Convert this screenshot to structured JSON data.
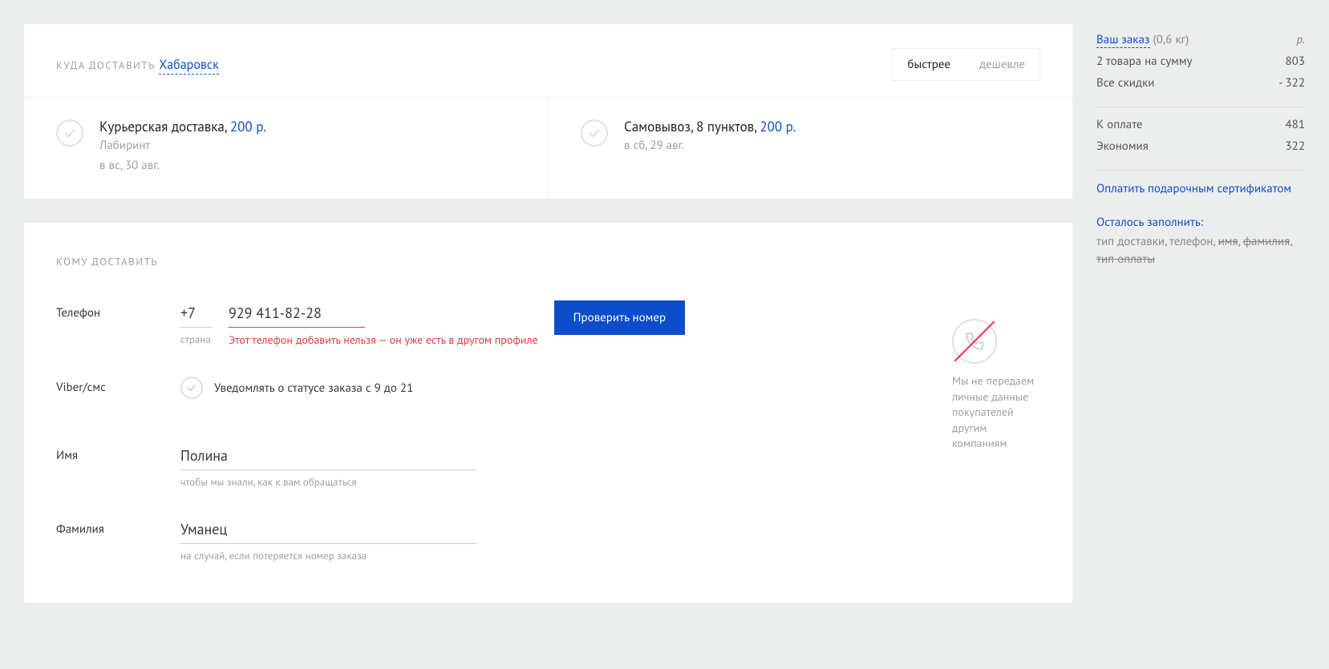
{
  "delivery_section": {
    "label": "КУДА ДОСТАВИТЬ",
    "city": "Хабаровск",
    "toggle": {
      "faster": "быстрее",
      "cheaper": "дешевле"
    },
    "options": [
      {
        "title": "Курьерская доставка,",
        "price": "200 р.",
        "line2": "Лабиринт",
        "line3": "в вс, 30 авг."
      },
      {
        "title": "Самовывоз, 8 пунктов,",
        "price": "200 р.",
        "line2": "в сб, 29 авг."
      }
    ]
  },
  "recipient_section": {
    "label": "КОМУ ДОСТАВИТЬ",
    "phone_label": "Телефон",
    "country_code": "+7",
    "country_hint": "страна",
    "phone_value": "929 411-82-28",
    "phone_error": "Этот телефон добавить нельзя — он уже есть в другом профиле",
    "verify_btn": "Проверить номер",
    "viber_label": "Viber/смс",
    "viber_text": "Уведомлять о статусе заказа с 9 до 21",
    "name_label": "Имя",
    "name_value": "Полина",
    "name_hint": "чтобы мы знали, как к вам обращаться",
    "surname_label": "Фамилия",
    "surname_value": "Уманец",
    "surname_hint": "на случай, если потеряется номер заказа",
    "privacy_text": "Мы не передаем личные данные покупателей другим компаниям"
  },
  "order": {
    "title": "Ваш заказ",
    "weight": "(0,6 кг)",
    "currency": "р.",
    "items_label": "2 товара на сумму",
    "items_value": "803",
    "discount_label": "Все скидки",
    "discount_value": "- 322",
    "total_label": "К оплате",
    "total_value": "481",
    "save_label": "Экономия",
    "save_value": "322",
    "gift_link": "Оплатить подарочным сертификатом",
    "remaining_title": "Осталось заполнить:",
    "remaining_items": [
      {
        "text": "тип доставки",
        "done": false
      },
      {
        "text": "телефон",
        "done": false
      },
      {
        "text": "имя",
        "done": true
      },
      {
        "text": "фамилия",
        "done": true
      },
      {
        "text": "тип оплаты",
        "done": true
      }
    ]
  }
}
